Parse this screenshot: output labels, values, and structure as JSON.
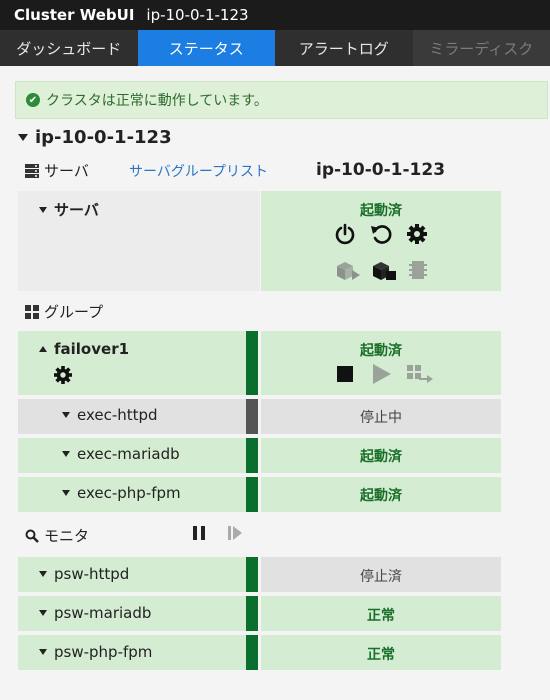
{
  "titlebar": {
    "app": "Cluster WebUI",
    "host": "ip-10-0-1-123"
  },
  "tabs": [
    {
      "label": "ダッシュボード"
    },
    {
      "label": "ステータス"
    },
    {
      "label": "アラートログ"
    },
    {
      "label": "ミラーディスク"
    }
  ],
  "alert": {
    "message": "クラスタは正常に動作しています。"
  },
  "cluster": {
    "name": "ip-10-0-1-123"
  },
  "server_section": {
    "title": "サーバ",
    "group_list_link": "サーバグループリスト",
    "server_column": "ip-10-0-1-123",
    "row_label": "サーバ",
    "status": "起動済"
  },
  "group_section": {
    "title": "グループ",
    "group": {
      "name": "failover1",
      "status": "起動済"
    },
    "resources": [
      {
        "name": "exec-httpd",
        "status": "停止中"
      },
      {
        "name": "exec-mariadb",
        "status": "起動済"
      },
      {
        "name": "exec-php-fpm",
        "status": "起動済"
      }
    ]
  },
  "monitor_section": {
    "title": "モニタ",
    "monitors": [
      {
        "name": "psw-httpd",
        "status": "停止済"
      },
      {
        "name": "psw-mariadb",
        "status": "正常"
      },
      {
        "name": "psw-php-fpm",
        "status": "正常"
      }
    ]
  },
  "colors": {
    "accent": "#1c7ee2",
    "ok_green": "#0a6e2c",
    "cell_green": "#d4edd2",
    "cell_gray": "#e1e1e1"
  },
  "icons": [
    "check-circle-icon",
    "server-icon",
    "power-icon",
    "restart-icon",
    "gear-icon",
    "box-icon",
    "grid-icon",
    "stop-icon",
    "play-icon",
    "move-icon",
    "search-icon",
    "pause-icon",
    "resume-icon"
  ]
}
